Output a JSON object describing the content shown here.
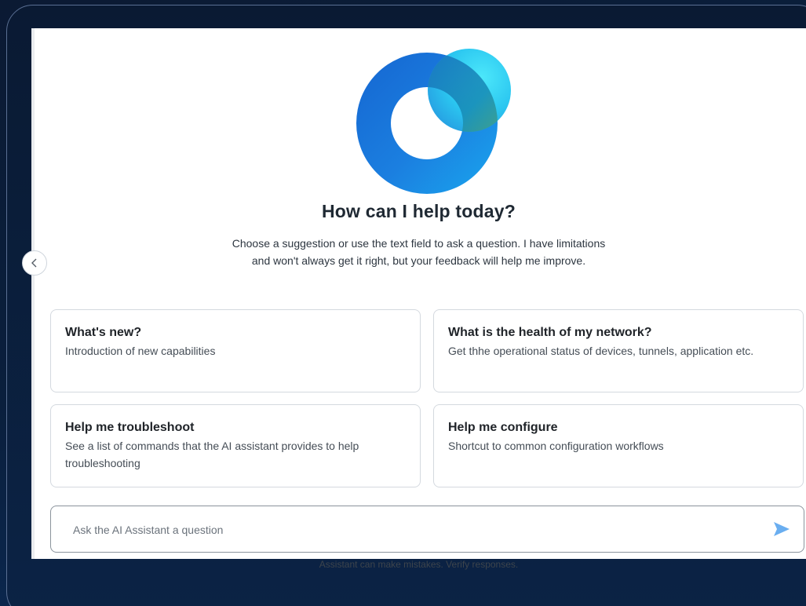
{
  "greeting": {
    "title": "How can I help today?",
    "subtitle_line1": "Choose a suggestion or use the text field to ask a question. I have limitations",
    "subtitle_line2": "and won't always get it right, but your feedback will help me improve."
  },
  "suggestions": [
    {
      "title": "What's new?",
      "description": "Introduction of new capabilities"
    },
    {
      "title": "What is the health of my network?",
      "description": "Get thhe operational status of devices, tunnels, application etc."
    },
    {
      "title": "Help me troubleshoot",
      "description": "See a list of commands that the AI assistant provides to help troubleshooting"
    },
    {
      "title": "Help me configure",
      "description": "Shortcut to common configuration workflows"
    }
  ],
  "input": {
    "placeholder": "Ask the AI Assistant a question",
    "value": ""
  },
  "disclaimer": "Assistant can make mistakes. Verify responses.",
  "icons": {
    "logo": "ai-assistant-logo",
    "send": "send-icon",
    "collapse": "chevron-left-icon"
  },
  "colors": {
    "send": "#6aaef0",
    "logo_blue": "#1b72d9",
    "logo_cyan": "#27d3f5",
    "logo_green": "#6fb24a"
  }
}
